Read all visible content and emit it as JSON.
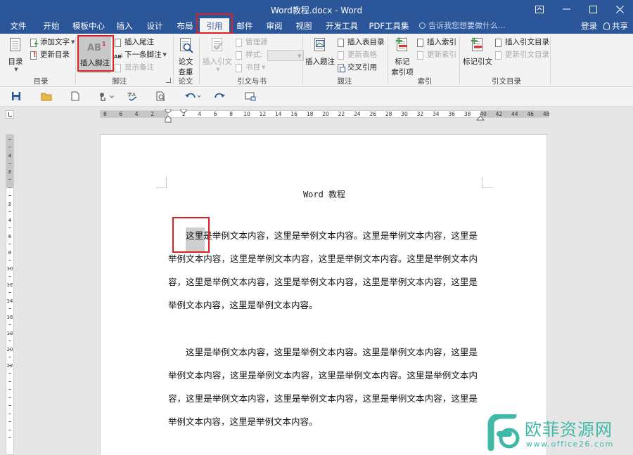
{
  "window": {
    "title": "Word教程.docx - Word"
  },
  "tabs": [
    "文件",
    "开始",
    "模板中心",
    "插入",
    "设计",
    "布局",
    "引用",
    "邮件",
    "审阅",
    "视图",
    "开发工具",
    "PDF工具集"
  ],
  "active_tab": "引用",
  "tell_me": "告诉我您想要做什么...",
  "login_label": "登录",
  "share_label": "共享",
  "ribbon": {
    "toc": {
      "group_label": "目录",
      "toc_button": "目录",
      "add_text": "添加文字",
      "update_toc": "更新目录"
    },
    "footnotes": {
      "group_label": "脚注",
      "insert_footnote": "插入脚注",
      "insert_endnote": "插入尾注",
      "next_footnote": "下一条脚注",
      "show_notes": "显示备注",
      "footnote_icon_text": "AB",
      "footnote_sup": "1"
    },
    "research": {
      "group_label": "论文",
      "paper_check_line1": "论文",
      "paper_check_line2": "查重"
    },
    "citations": {
      "group_label": "引文与书目",
      "insert_citation": "插入引文",
      "manage_sources": "管理源",
      "style_label": "样式:",
      "bibliography": "书目"
    },
    "captions": {
      "group_label": "题注",
      "insert_caption": "插入题注",
      "insert_table_of_figures": "插入表目录",
      "update_table": "更新表格",
      "cross_reference": "交叉引用"
    },
    "index": {
      "group_label": "索引",
      "mark_entry_line1": "标记",
      "mark_entry_line2": "索引项",
      "insert_index": "插入索引",
      "update_index": "更新索引"
    },
    "toa": {
      "group_label": "引文目录",
      "mark_citation": "标记引文",
      "insert_toa": "插入引文目录",
      "update_toa": "更新引文目录"
    }
  },
  "ruler": {
    "horizontal": [
      "8",
      "6",
      "4",
      "2",
      "2",
      "4",
      "6",
      "8",
      "10",
      "12",
      "14",
      "16",
      "18",
      "20",
      "22",
      "24",
      "26",
      "28",
      "30",
      "32",
      "34",
      "36",
      "38",
      "40",
      "42",
      "44",
      "46",
      "48"
    ],
    "vertical": [
      "4",
      "2",
      "2",
      "4",
      "6",
      "8",
      "10",
      "12",
      "14",
      "16",
      "18",
      "20",
      "22"
    ]
  },
  "document": {
    "header": "Word 教程",
    "paragraph1": "这里是举例文本内容，这里是举例文本内容。这里是举例文本内容，这里是举例文本内容，这里是举例文本内容，这里是举例文本内容。这里是举例文本内容，这里是举例文本内容，这里是举例文本内容，这里是举例文本内容，这里是举例文本内容，这里是举例文本内容。",
    "paragraph2": "这里是举例文本内容，这里是举例文本内容。这里是举例文本内容，这里是举例文本内容，这里是举例文本内容，这里是举例文本内容。这里是举例文本内容，这里是举例文本内容，这里是举例文本内容，这里是举例文本内容，这里是举例文本内容，这里是举例文本内容。"
  },
  "watermark": {
    "brand": "欧菲资源网",
    "url": "www.office26.com"
  },
  "colors": {
    "title_bar": "#2b579a",
    "highlight": "#e02020",
    "watermark": "#3fb8a8"
  }
}
